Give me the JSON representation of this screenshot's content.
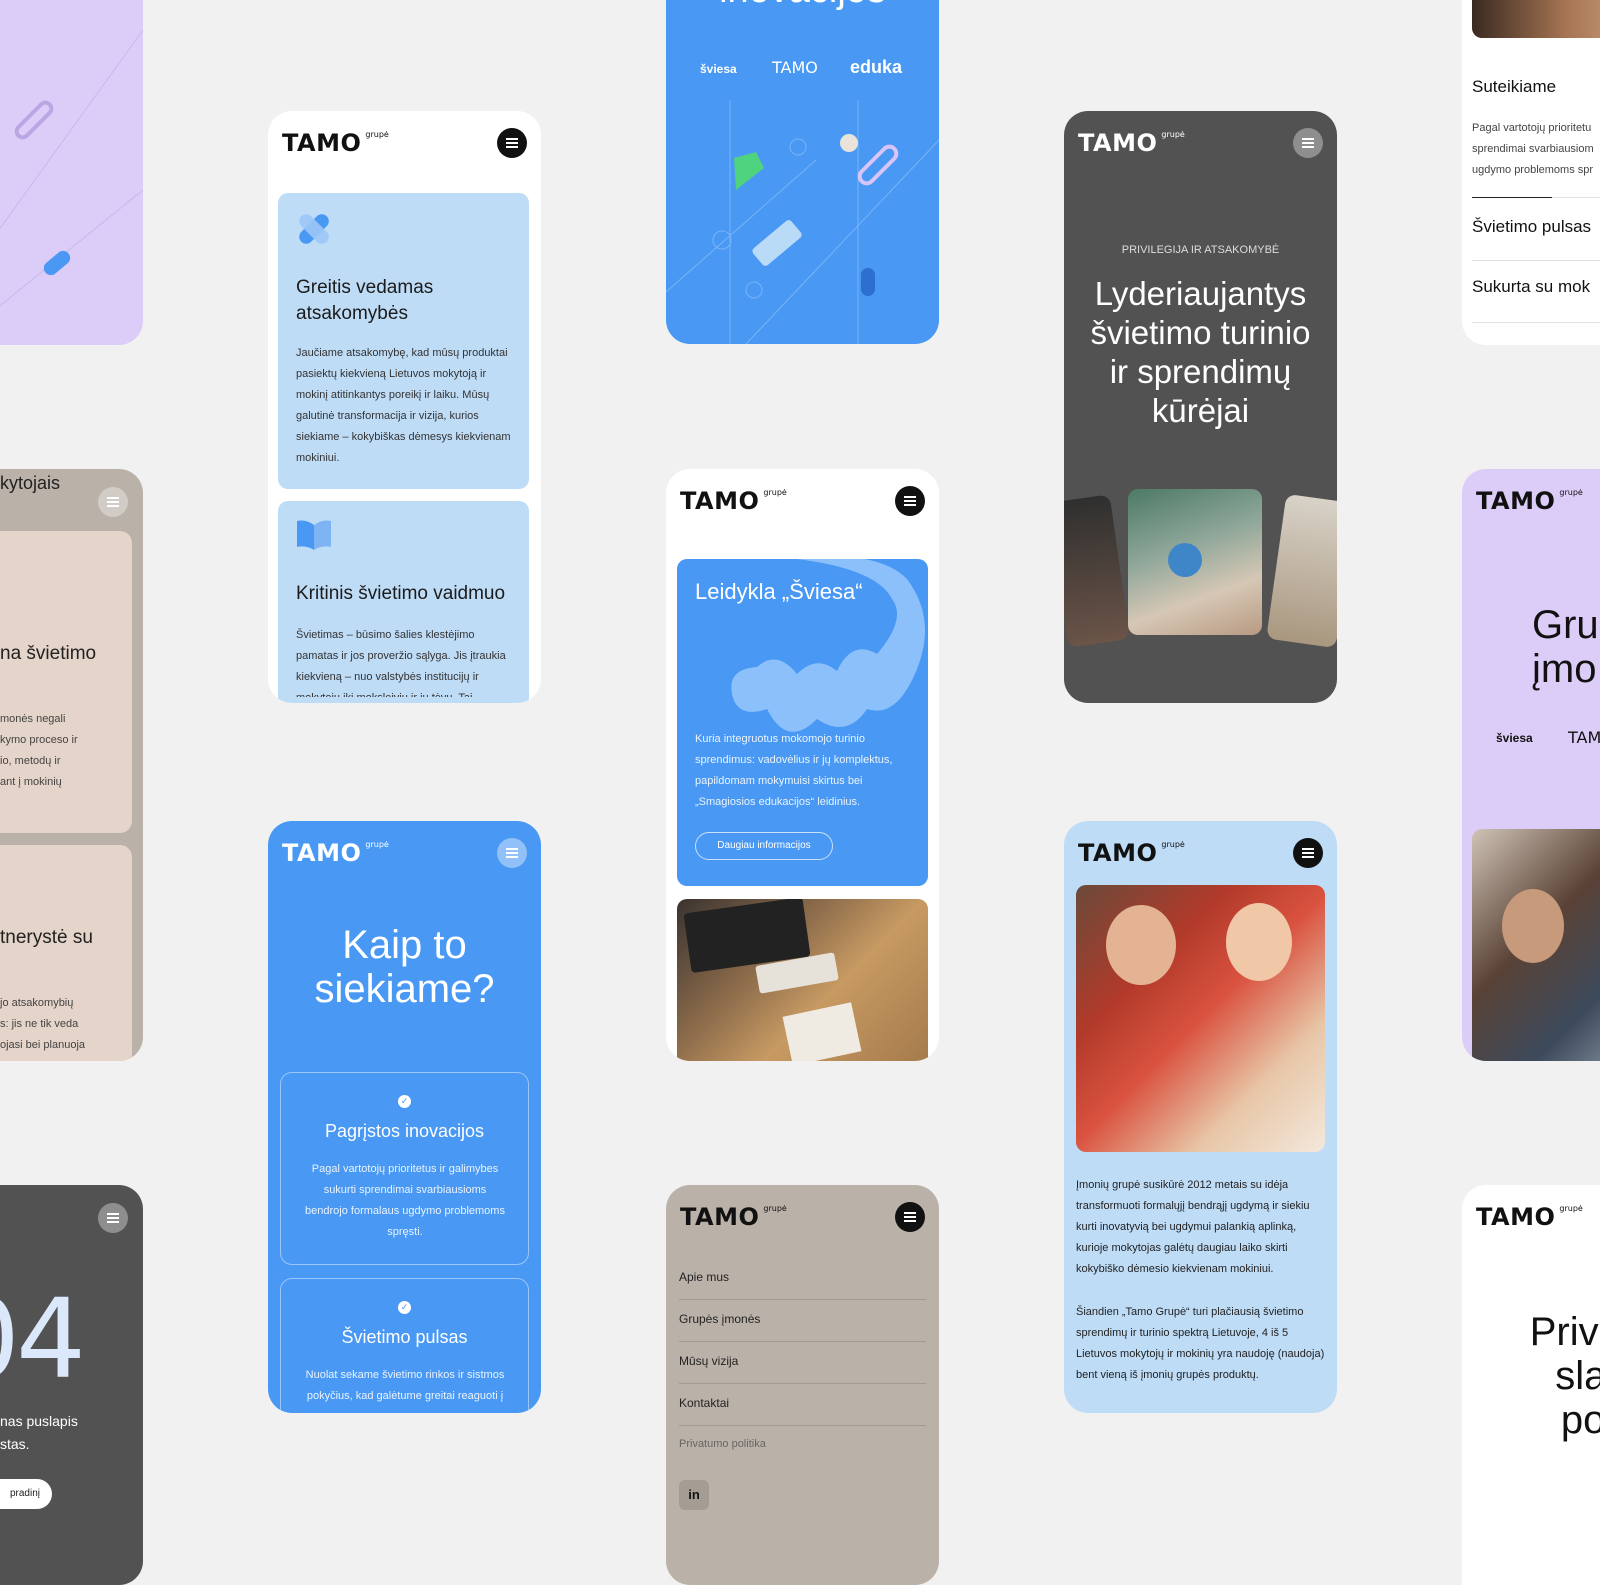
{
  "brand": {
    "logo": "TAMO",
    "suffix": "grupė"
  },
  "colors": {
    "background": "#f1f1f1",
    "blue": "#4898f4",
    "light_blue": "#bfdcf7",
    "lavender": "#dccdf8",
    "dark_gray": "#525252",
    "taupe": "#bab1a8",
    "beige": "#e4d4c9"
  },
  "card_left_beige": {
    "title": "kytojais",
    "item1_title": "na švietimo",
    "item1_lines": [
      "monės negali",
      "kymo proceso ir",
      "io, metodų ir",
      "ant į mokinių"
    ],
    "item2_title": "tnerystė su",
    "item2_lines": [
      "jo atsakomybių",
      "s: jis ne tik veda",
      "ojasi bei planuoja"
    ]
  },
  "card_left_404": {
    "number": "04",
    "line1": "nas puslapis",
    "line2": "stas.",
    "button": "pradinį"
  },
  "card_values": {
    "item1_title": "Greitis vedamas atsakomybės",
    "item1_text": "Jaučiame atsakomybę, kad mūsų produktai pasiektų kiekvieną Lietuvos mokytoją ir mokinį atitinkantys poreikį ir laiku. Mūsų galutinė transformacija ir vizija, kurios siekiame – kokybiškas dėmesys kiekvienam mokiniui.",
    "item2_title": "Kritinis švietimo vaidmuo",
    "item2_text": "Švietimas – būsimo šalies klestėjimo pamatas ir jos proveržio sąlyga. Jis įtraukia kiekvieną – nuo valstybės institucijų ir mokytojų iki moksleivių ir jų tėvų. Tai"
  },
  "card_how": {
    "heading": "Kaip to siekiame?",
    "item1_title": "Pagrįstos inovacijos",
    "item1_text": "Pagal vartotojų prioritetus ir galimybes sukurti sprendimai svarbiausioms bendrojo formalaus ugdymo problemoms spręsti.",
    "item2_title": "Švietimo pulsas",
    "item2_text": "Nuolat sekame švietimo rinkos ir sistmos pokyčius, kad galėtume greitai reaguoti į"
  },
  "card_innov": {
    "heading": "inovacijos",
    "logos": [
      "šviesa",
      "TAMO",
      "eduka"
    ]
  },
  "card_sviesa": {
    "title": "Leidykla „Šviesa“",
    "text": "Kuria integruotus mokomojo turinio sprendimus: vadovėlius ir jų komplektus, papildomam mokymuisi skirtus bei „Smagiosios edukacijos“ leidinius.",
    "button": "Daugiau informacijos"
  },
  "card_menu": {
    "items": [
      "Apie mus",
      "Grupės įmonės",
      "Mūsų vizija",
      "Kontaktai"
    ],
    "privacy": "Privatumo politika",
    "social": "in"
  },
  "card_leaders": {
    "kicker": "PRIVILEGIJA IR ATSAKOMYBĖ",
    "heading": "Lyderiaujantys švietimo turinio ir sprendimų kūrėjai"
  },
  "card_about": {
    "p1": "Įmonių grupė susikūrė 2012 metais su idėja transformuoti formalųjį bendrąjį ugdymą ir siekiu kurti inovatyvią bei ugdymui palankią aplinką, kurioje mokytojas galėtų daugiau laiko skirti kokybiško dėmesio kiekvienam mokiniui.",
    "p2": "Šiandien „Tamo Grupė“ turi plačiausią švietimo sprendimų ir turinio spektrą Lietuvoje, 4 iš 5 Lietuvos mokytojų ir mokinių yra naudoję (naudoja) bent vieną iš įmonių grupės produktų."
  },
  "card_right_top": {
    "title": "Suteikiame",
    "text_lines": [
      "Pagal vartotojų prioritetu",
      "sprendimai svarbiausiom",
      "ugdymo problemoms spr"
    ],
    "item2": "Švietimo pulsas",
    "item3": "Sukurta su mok"
  },
  "card_right_lavender": {
    "heading_line1": "Gru",
    "heading_line2": "įmo",
    "logos": [
      "šviesa",
      "TAM"
    ]
  },
  "card_right_privacy": {
    "line1": "Privatu",
    "line2": "slap",
    "line3": "poli"
  }
}
